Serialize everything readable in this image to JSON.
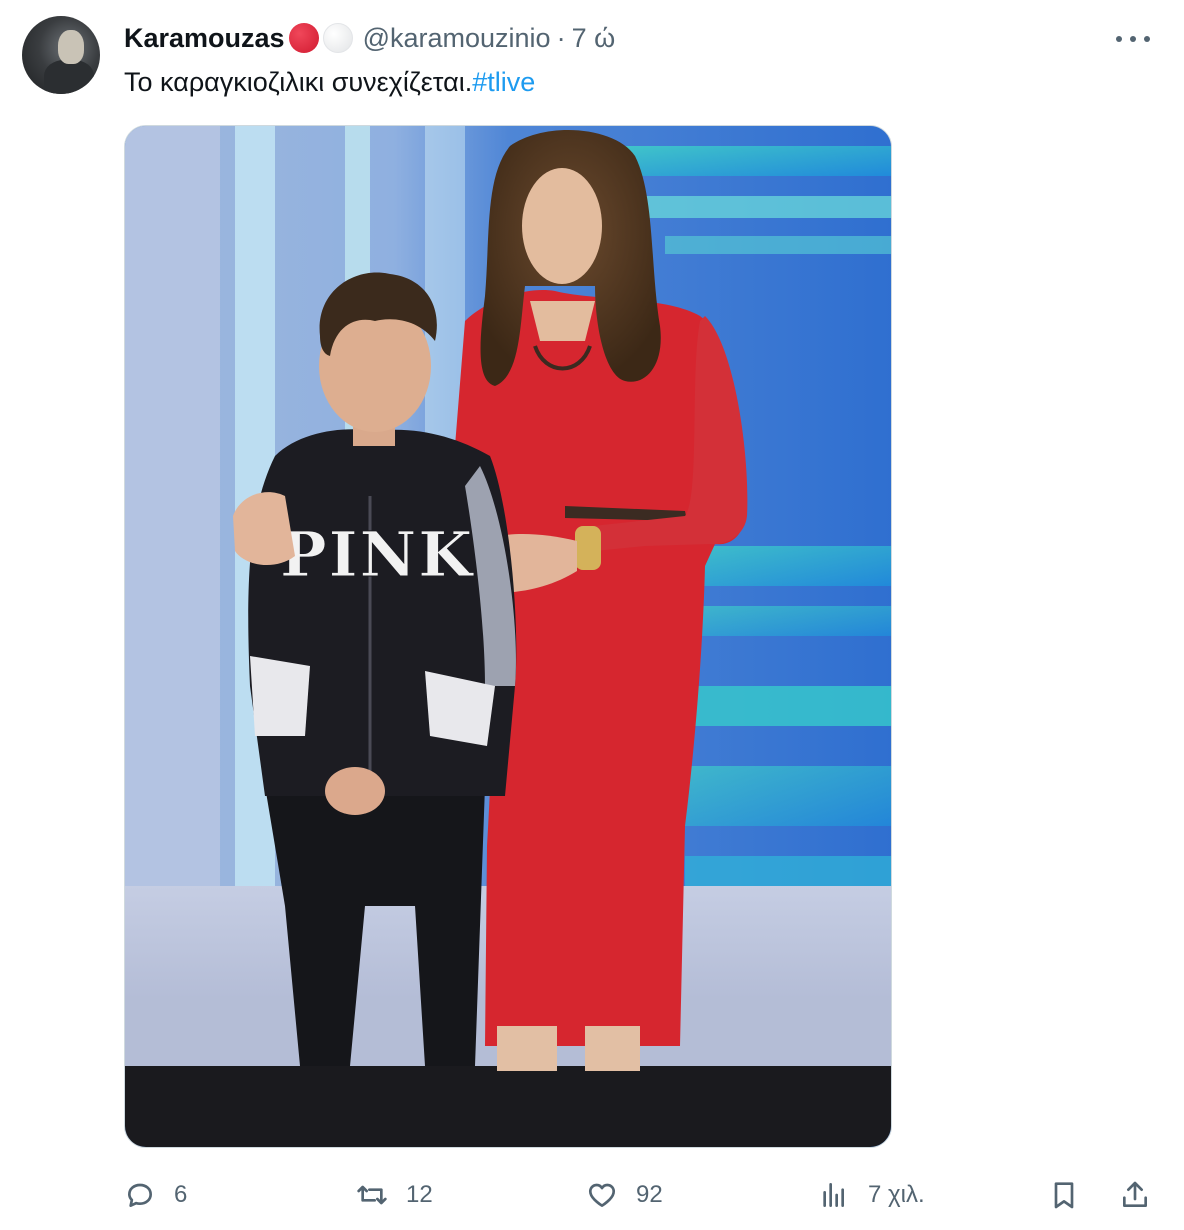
{
  "tweet": {
    "display_name": "Karamouzas",
    "handle": "@karamouzinio",
    "separator": "·",
    "time": "7 ώ",
    "text": "Το καραγκιοζιλικι συνεχίζεται.",
    "hashtag": "#tlive",
    "badges": [
      "red-circle-emoji",
      "white-circle-emoji"
    ],
    "media": {
      "alt": "",
      "printed_text": "PINK"
    }
  },
  "actions": {
    "reply_count": "6",
    "retweet_count": "12",
    "like_count": "92",
    "views_count": "7 χιλ."
  },
  "icons": {
    "more": "more-horizontal-icon",
    "reply": "reply-icon",
    "retweet": "retweet-icon",
    "like": "heart-icon",
    "views": "analytics-icon",
    "bookmark": "bookmark-icon",
    "share": "share-icon"
  },
  "colors": {
    "text_primary": "#0f1419",
    "text_secondary": "#536471",
    "link": "#1d9bf0",
    "dress_red": "#d6262f"
  }
}
